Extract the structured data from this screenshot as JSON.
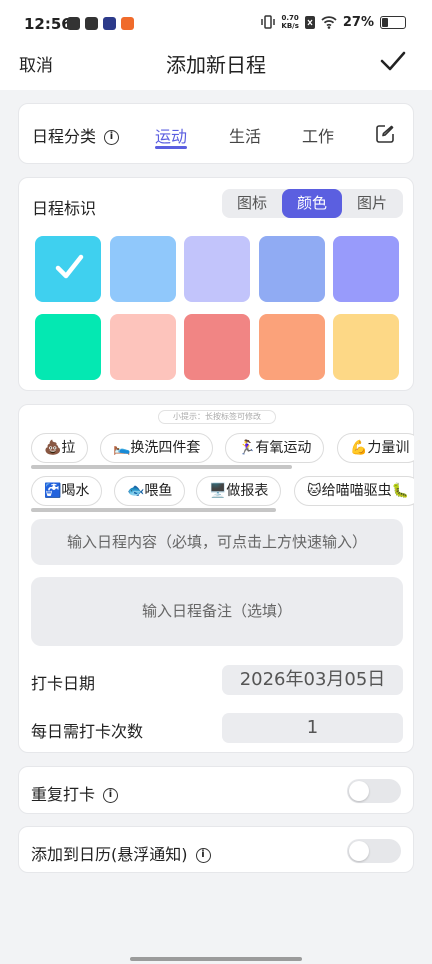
{
  "status_bar": {
    "time": "12:56",
    "net_speed_top": "0.70",
    "net_speed_bottom": "KB/s",
    "battery": "27%",
    "battery_level": 0.27
  },
  "header": {
    "cancel": "取消",
    "title": "添加新日程",
    "confirm_icon": "checkmark-icon"
  },
  "category": {
    "label": "日程分类",
    "info_icon": "i",
    "tabs": [
      {
        "label": "运动",
        "active": true
      },
      {
        "label": "生活"
      },
      {
        "label": "工作"
      }
    ],
    "edit_icon": "edit-icon"
  },
  "identifier": {
    "label": "日程标识",
    "modes": [
      "图标",
      "颜色",
      "图片"
    ],
    "active_mode": "颜色",
    "colors": [
      "#3fd0ef",
      "#90c8fb",
      "#c2c4fb",
      "#90abf3",
      "#989bfb",
      "#04e8b2",
      "#fdc4bc",
      "#f18584",
      "#fba27a",
      "#fdd886"
    ],
    "selected_color_index": 0
  },
  "tags": {
    "hint": "小提示：长按标签可修改",
    "row1": [
      "💩拉",
      "🛌换洗四件套",
      "🏃‍♀️有氧运动",
      "💪力量训"
    ],
    "row2": [
      "🚰喝水",
      "🐟喂鱼",
      "🖥️做报表",
      "🐱给喵喵驱虫🐛"
    ]
  },
  "content_input": {
    "placeholder": "输入日程内容（必填，可点击上方快速输入）"
  },
  "note_input": {
    "placeholder": "输入日程备注（选填）"
  },
  "checkin_date": {
    "label": "打卡日期",
    "value": "2026年03月05日"
  },
  "daily_count": {
    "label": "每日需打卡次数",
    "value": "1"
  },
  "repeat": {
    "label": "重复打卡",
    "info_icon": "i",
    "enabled": false
  },
  "calendar": {
    "label": "添加到日历(悬浮通知)",
    "info_icon": "i",
    "enabled": false
  }
}
